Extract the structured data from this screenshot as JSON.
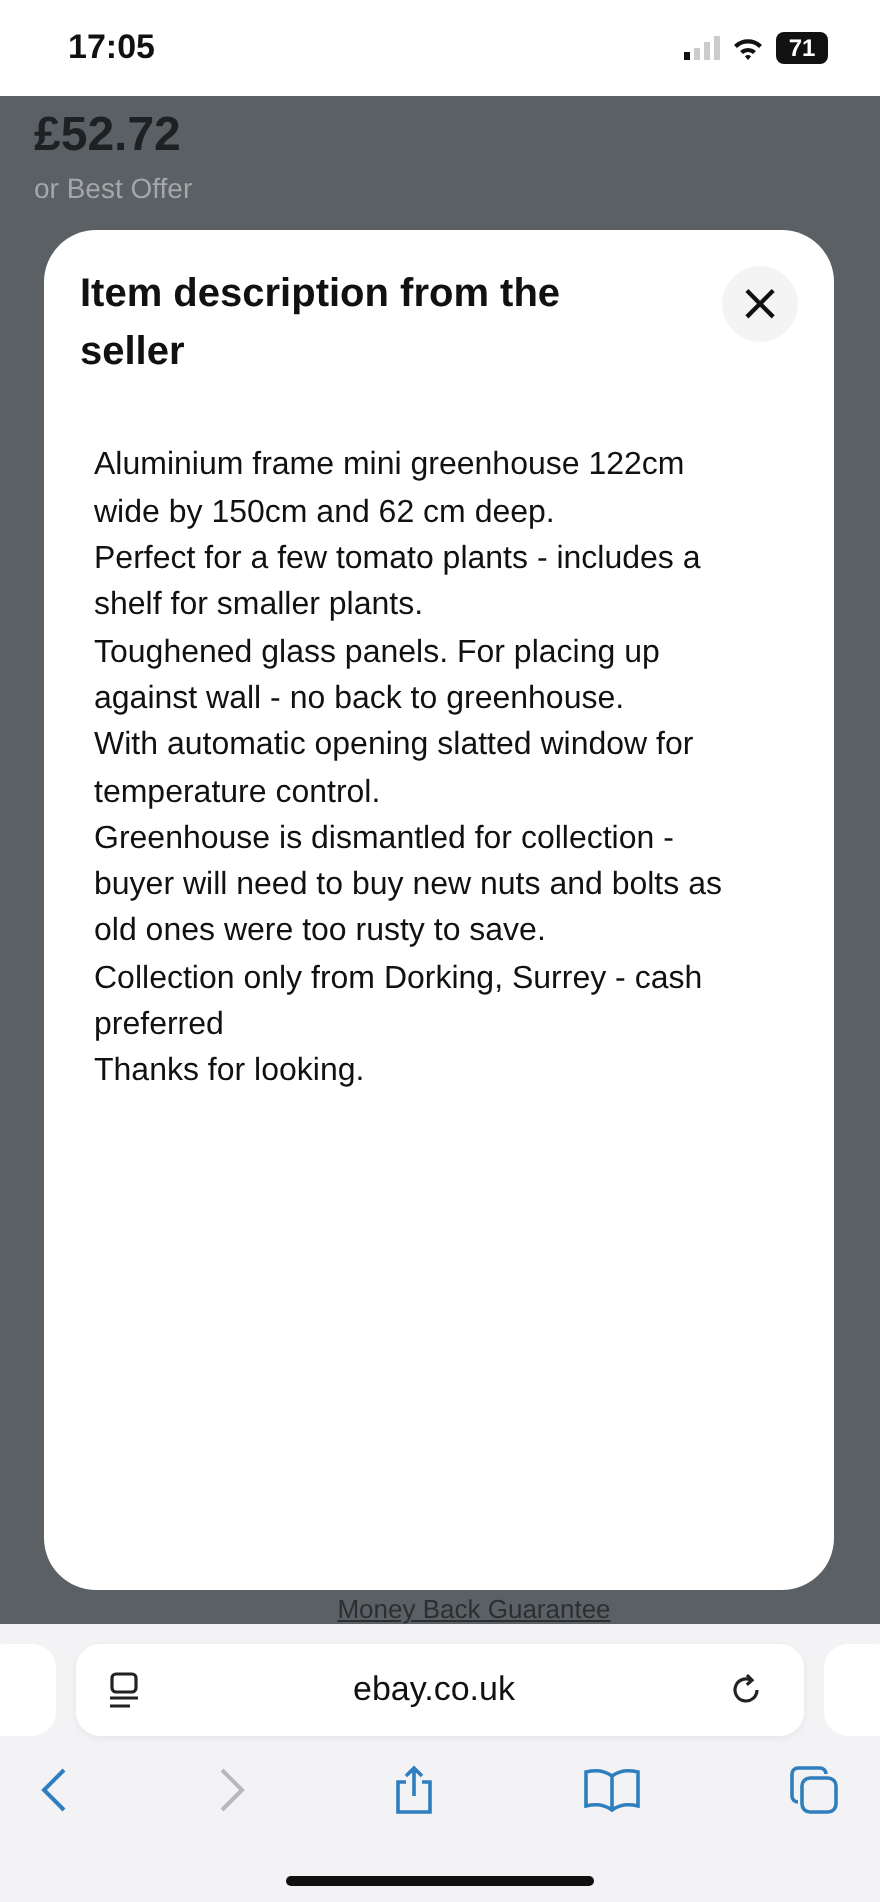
{
  "status_bar": {
    "time": "17:05",
    "battery": "71"
  },
  "listing": {
    "price": "£52.72",
    "offer": "or Best Offer",
    "guarantee": "Money Back Guarantee"
  },
  "dialog": {
    "title": "Item description from the seller",
    "close": "×",
    "paragraphs": [
      "Aluminium frame mini greenhouse 122cm wide by 150cm and 62 cm deep.",
      "Perfect for a few tomato plants - includes a shelf for smaller plants.",
      "Toughened glass panels. For placing up against wall - no back to greenhouse.",
      "With automatic opening slatted window for temperature control.",
      "Greenhouse is dismantled for collection - buyer will need to buy new nuts and bolts as old ones were too rusty to save.",
      "Collection only from Dorking, Surrey - cash preferred",
      "Thanks for looking."
    ]
  },
  "browser": {
    "url": "ebay.co.uk",
    "forward_disabled": true
  }
}
